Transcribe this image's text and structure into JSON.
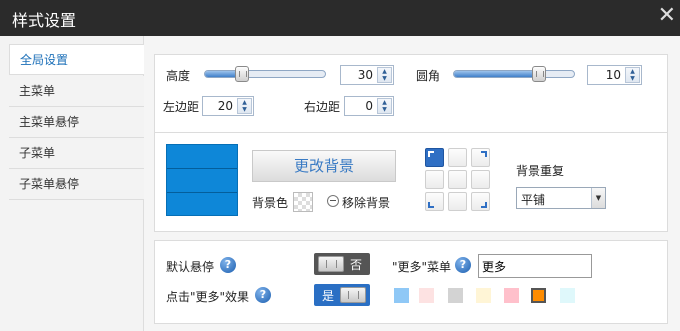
{
  "window": {
    "title": "样式设置",
    "close_symbol": "✕"
  },
  "sidebar": {
    "items": [
      {
        "label": "全局设置",
        "active": true
      },
      {
        "label": "主菜单",
        "active": false
      },
      {
        "label": "主菜单悬停",
        "active": false
      },
      {
        "label": "子菜单",
        "active": false
      },
      {
        "label": "子菜单悬停",
        "active": false
      }
    ]
  },
  "size": {
    "height_label": "高度",
    "height_value": "30",
    "height_slider_percent": 30,
    "radius_label": "圆角",
    "radius_value": "10",
    "radius_slider_percent": 67,
    "left_margin_label": "左边距",
    "left_margin_value": "20",
    "right_margin_label": "右边距",
    "right_margin_value": "0"
  },
  "background": {
    "preview_color": "#0e87d8",
    "change_button": "更改背景",
    "bg_color_label": "背景色",
    "remove_label": "移除背景",
    "repeat_label": "背景重复",
    "repeat_value": "平铺",
    "position_selected": "top-left"
  },
  "behavior": {
    "default_hover_label": "默认悬停",
    "default_hover_state": "否",
    "more_menu_label": "\"更多\"菜单",
    "more_menu_value": "更多",
    "click_more_label": "点击\"更多\"效果",
    "click_more_state": "是",
    "colors": [
      "#8fc8f6",
      "#fde2e2",
      "#d3d3d3",
      "#fff5d6",
      "#ffc0cb",
      "#ff8c00",
      "#dff8fb"
    ],
    "selected_color": "#ff8c00"
  },
  "icons": {
    "help": "?",
    "spin_up": "▲",
    "spin_down": "▼",
    "dropdown": "▼"
  }
}
